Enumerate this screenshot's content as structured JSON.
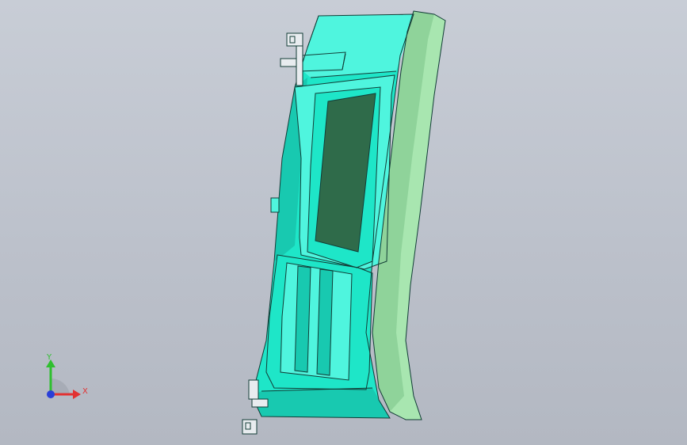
{
  "viewport": {
    "background_top": "#c8cdd6",
    "background_bottom": "#b3b8c2"
  },
  "model": {
    "part_color": "#1ee6c8",
    "part_shade": "#18c9b0",
    "part_highlight": "#4ff5de",
    "face_color": "#2f6b4a",
    "edge_color": "#123c36",
    "bezel_color": "#a8e6b0",
    "clip_color": "#e8ecef"
  },
  "triad": {
    "x_label": "X",
    "y_label": "Y",
    "x_color": "#e23232",
    "y_color": "#2fbf2f",
    "z_color": "#2a3fd8"
  }
}
